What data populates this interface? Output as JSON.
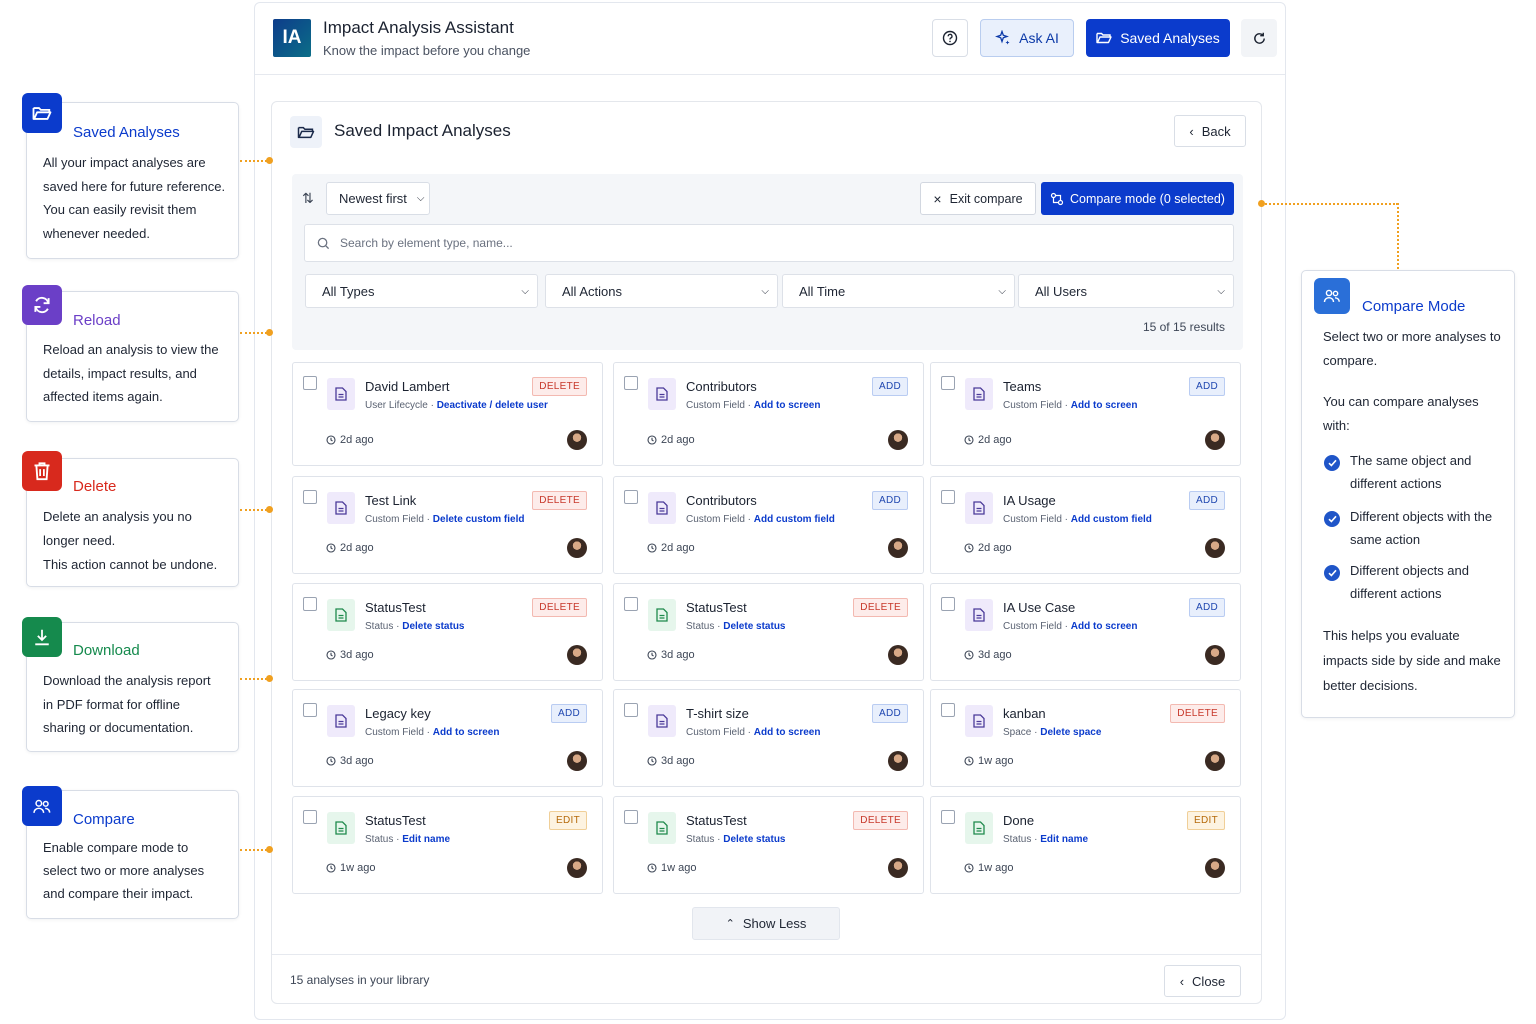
{
  "header": {
    "logo_text": "IA",
    "title": "Impact Analysis Assistant",
    "subtitle": "Know the impact before you change",
    "ask_ai_label": "Ask AI",
    "saved_label": "Saved Analyses"
  },
  "panel": {
    "title": "Saved Impact Analyses",
    "back_label": "Back",
    "sort_label": "Newest first",
    "exit_compare_label": "Exit compare",
    "compare_mode_label": "Compare mode (0 selected)",
    "search_placeholder": "Search by element type, name...",
    "filters": [
      "All Types",
      "All Actions",
      "All Time",
      "All Users"
    ],
    "results_text": "15 of 15 results",
    "show_less_label": "Show Less",
    "footer_text": "15 analyses in your library",
    "close_label": "Close"
  },
  "cards": [
    {
      "title": "David Lambert",
      "type": "User Lifecycle",
      "action": "Deactivate / delete user",
      "badge": "DELETE",
      "time": "2d ago",
      "icon_color": "purple"
    },
    {
      "title": "Contributors",
      "type": "Custom Field",
      "action": "Add to screen",
      "badge": "ADD",
      "time": "2d ago",
      "icon_color": "purple"
    },
    {
      "title": "Teams",
      "type": "Custom Field",
      "action": "Add to screen",
      "badge": "ADD",
      "time": "2d ago",
      "icon_color": "purple"
    },
    {
      "title": "Test Link",
      "type": "Custom Field",
      "action": "Delete custom field",
      "badge": "DELETE",
      "time": "2d ago",
      "icon_color": "purple"
    },
    {
      "title": "Contributors",
      "type": "Custom Field",
      "action": "Add custom field",
      "badge": "ADD",
      "time": "2d ago",
      "icon_color": "purple"
    },
    {
      "title": "IA Usage",
      "type": "Custom Field",
      "action": "Add custom field",
      "badge": "ADD",
      "time": "2d ago",
      "icon_color": "purple"
    },
    {
      "title": "StatusTest",
      "type": "Status",
      "action": "Delete status",
      "badge": "DELETE",
      "time": "3d ago",
      "icon_color": "green"
    },
    {
      "title": "StatusTest",
      "type": "Status",
      "action": "Delete status",
      "badge": "DELETE",
      "time": "3d ago",
      "icon_color": "green"
    },
    {
      "title": "IA Use Case",
      "type": "Custom Field",
      "action": "Add to screen",
      "badge": "ADD",
      "time": "3d ago",
      "icon_color": "purple"
    },
    {
      "title": "Legacy key",
      "type": "Custom Field",
      "action": "Add to screen",
      "badge": "ADD",
      "time": "3d ago",
      "icon_color": "purple"
    },
    {
      "title": "T-shirt size",
      "type": "Custom Field",
      "action": "Add to screen",
      "badge": "ADD",
      "time": "3d ago",
      "icon_color": "purple"
    },
    {
      "title": "kanban",
      "type": "Space",
      "action": "Delete space",
      "badge": "DELETE",
      "time": "1w ago",
      "icon_color": "purple"
    },
    {
      "title": "StatusTest",
      "type": "Status",
      "action": "Edit name",
      "badge": "EDIT",
      "time": "1w ago",
      "icon_color": "green"
    },
    {
      "title": "StatusTest",
      "type": "Status",
      "action": "Delete status",
      "badge": "DELETE",
      "time": "1w ago",
      "icon_color": "green"
    },
    {
      "title": "Done",
      "type": "Status",
      "action": "Edit name",
      "badge": "EDIT",
      "time": "1w ago",
      "icon_color": "green"
    }
  ],
  "callouts": [
    {
      "title": "Saved Analyses",
      "color": "#0b3bcc",
      "icon": "folder-open-icon",
      "lines": [
        "All your impact analyses are",
        "saved here for future reference.",
        "You can easily revisit them",
        "whenever needed."
      ]
    },
    {
      "title": "Reload",
      "color": "#6b3fc7",
      "icon": "reload-icon",
      "lines": [
        "Reload an analysis to view the",
        "details, impact results, and",
        "affected items again."
      ]
    },
    {
      "title": "Delete",
      "color": "#d8291d",
      "icon": "trash-icon",
      "lines": [
        "Delete an analysis you no",
        "longer need.",
        "This action cannot be undone."
      ]
    },
    {
      "title": "Download",
      "color": "#158a4d",
      "icon": "download-icon",
      "lines": [
        "Download the analysis report",
        "in PDF format for offline",
        "sharing or documentation."
      ]
    },
    {
      "title": "Compare",
      "color": "#0b3bcc",
      "icon": "users-icon",
      "lines": [
        "Enable compare mode to",
        "select two or more analyses",
        "and compare their impact."
      ]
    }
  ],
  "compare_info": {
    "title": "Compare Mode",
    "intro": "Select two or more analyses to compare.",
    "lead": "You can compare analyses with:",
    "items": [
      "The same object and different actions",
      "Different objects with the same action",
      "Different objects and different actions"
    ],
    "outro": "This helps you evaluate impacts side by side and make better decisions."
  },
  "colors": {
    "primary": "#0b3bcc",
    "accent_connector": "#f0a020",
    "delete": "#c7372a",
    "add": "#1f47b0",
    "edit": "#b56a0a"
  }
}
